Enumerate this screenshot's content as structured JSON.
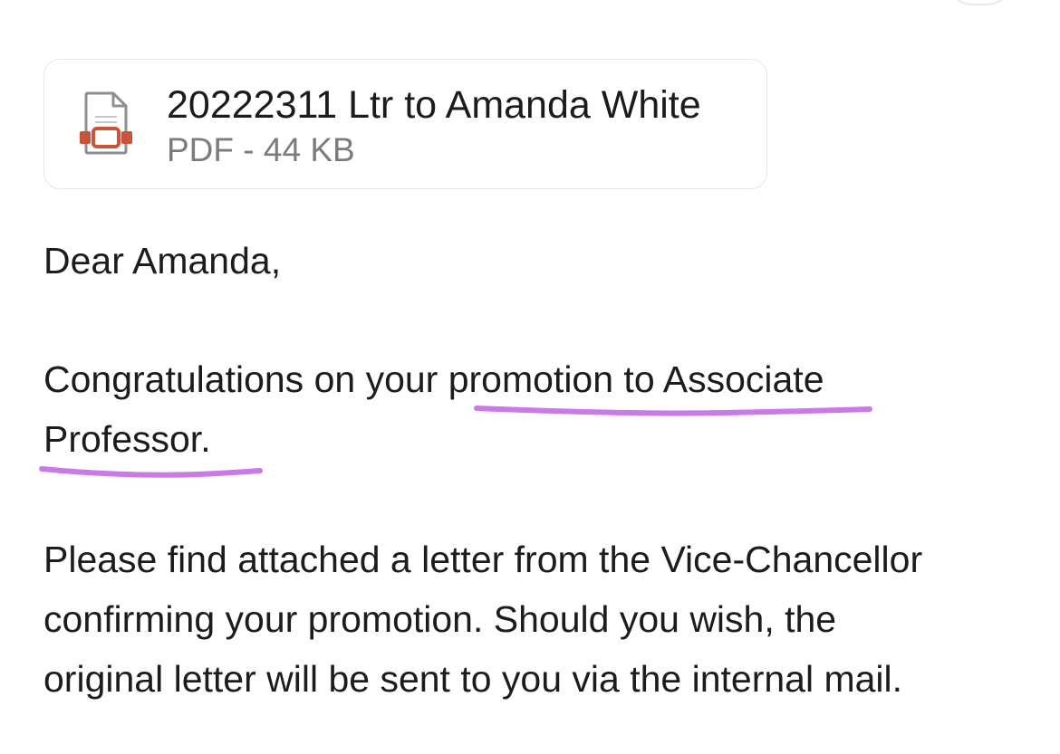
{
  "attachment": {
    "file_name": "20222311 Ltr to Amanda White",
    "file_meta": "PDF - 44 KB",
    "icon": "pdf-file-icon",
    "icon_accent_color": "#c8553a"
  },
  "message": {
    "greeting": "Dear Amanda,",
    "paragraph1_lines": [
      "Congratulations on your promotion to Associate",
      "Professor."
    ],
    "paragraph2_lines": [
      "Please find attached a letter from the Vice-Chancellor",
      "confirming your promotion.  Should you wish, the",
      "original letter will be sent to you via the internal mail."
    ]
  },
  "annotation": {
    "highlight_color": "#c97ae8"
  }
}
